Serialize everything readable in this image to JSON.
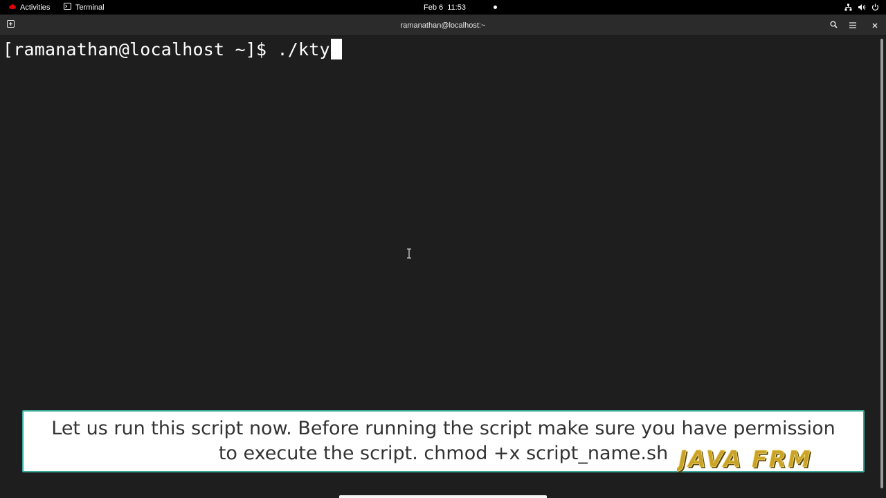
{
  "topbar": {
    "activities_label": "Activities",
    "app_label": "Terminal",
    "clock": "Feb 6  11:53",
    "icons": [
      "redhat-icon",
      "terminal-app-icon",
      "network-icon",
      "volume-icon",
      "power-icon"
    ]
  },
  "window": {
    "title": "ramanathan@localhost:~",
    "icons": [
      "new-tab-icon",
      "search-icon",
      "hamburger-menu-icon",
      "close-icon"
    ]
  },
  "terminal": {
    "prompt": "[ramanathan@localhost ~]$ ",
    "command": "./kty"
  },
  "caption": {
    "text": "Let us run this script now. Before running the script make sure you have permission to execute the script. chmod +x script_name.sh"
  },
  "watermark": {
    "text": "JAVA FRM"
  },
  "colors": {
    "terminal_bg": "#1e1e1e",
    "headerbar_bg": "#2b2b2b",
    "caption_border": "#3aa89a",
    "watermark_gold": "#c9a227"
  }
}
